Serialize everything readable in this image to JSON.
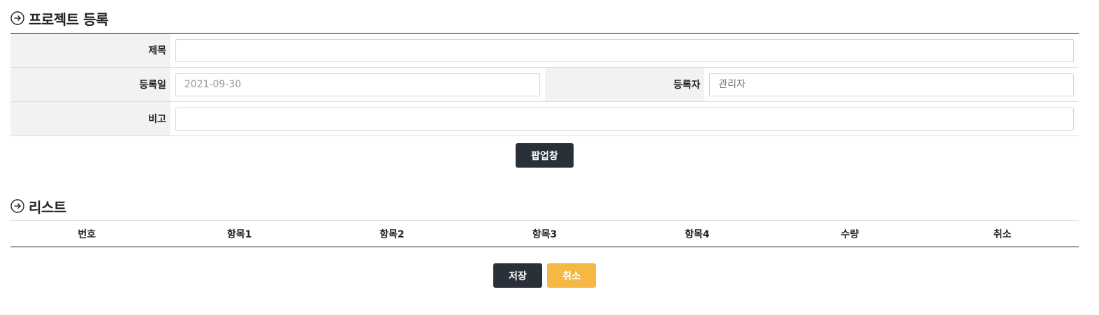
{
  "sections": {
    "register_title": "프로젝트 등록",
    "list_title": "리스트"
  },
  "form": {
    "title_label": "제목",
    "title_value": "",
    "date_label": "등록일",
    "date_value": "2021-09-30",
    "author_label": "등록자",
    "author_placeholder": "관리자",
    "note_label": "비고",
    "note_value": ""
  },
  "buttons": {
    "popup": "팝업창",
    "save": "저장",
    "cancel": "취소"
  },
  "list": {
    "columns": [
      "번호",
      "항목1",
      "항목2",
      "항목3",
      "항목4",
      "수량",
      "취소"
    ]
  },
  "colors": {
    "dark_button": "#293039",
    "cancel_button": "#f5b843",
    "header_bg": "#f2f2f2"
  },
  "icons": {
    "section_icon": "arrow-right-circle-icon"
  }
}
